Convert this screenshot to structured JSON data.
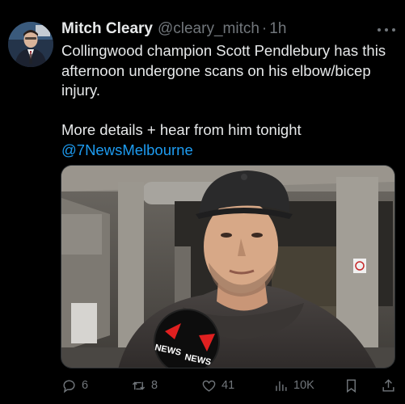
{
  "tweet": {
    "author_name": "Mitch Cleary",
    "handle": "@cleary_mitch",
    "separator": "·",
    "time": "1h",
    "text_line1": "Collingwood champion Scott Pendlebury has this afternoon undergone scans on his elbow/bicep injury.",
    "text_line2": "More details + hear from him tonight",
    "mention": "@7NewsMelbourne",
    "microphone_text": "NEWS"
  },
  "actions": {
    "replies": "6",
    "reposts": "8",
    "likes": "41",
    "views": "10K"
  },
  "icons": [
    "more-icon",
    "reply-icon",
    "repost-icon",
    "like-icon",
    "views-icon",
    "bookmark-icon",
    "share-icon"
  ],
  "colors": {
    "background": "#000000",
    "text": "#e7e9ea",
    "secondary": "#71767b",
    "link": "#1d9bf0"
  }
}
